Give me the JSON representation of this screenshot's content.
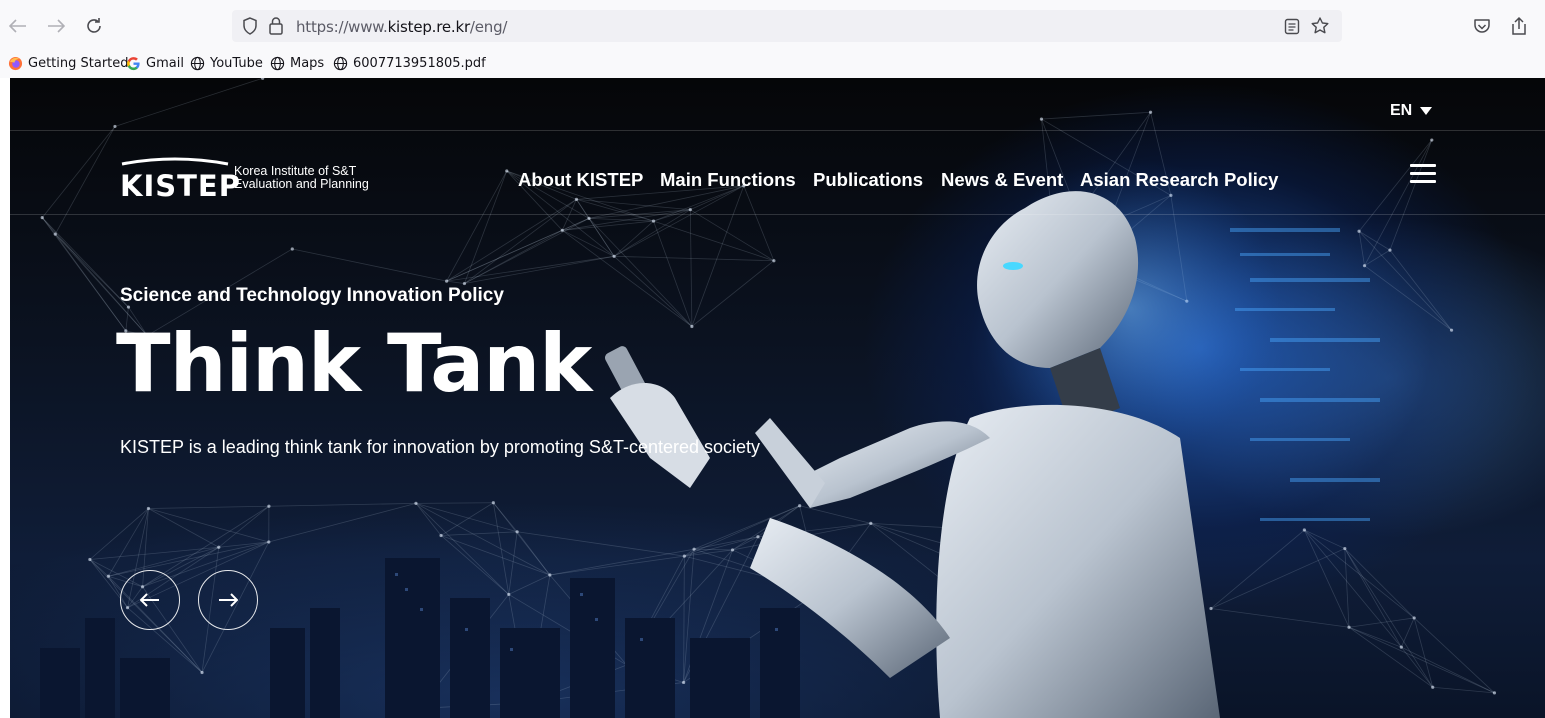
{
  "browser": {
    "url_prefix": "https://www.",
    "url_domain": "kistep.re.kr",
    "url_path": "/eng/",
    "bookmarks": [
      {
        "label": "Getting Started",
        "icon": "firefox-icon"
      },
      {
        "label": "Gmail",
        "icon": "google-icon"
      },
      {
        "label": "YouTube",
        "icon": "globe-icon"
      },
      {
        "label": "Maps",
        "icon": "globe-icon"
      },
      {
        "label": "6007713951805.pdf",
        "icon": "globe-icon"
      }
    ]
  },
  "site": {
    "language": "EN",
    "logo_text": "KISTEP",
    "logo_sub_line1": "Korea Institute of S&T",
    "logo_sub_line2": "Evaluation and Planning",
    "nav": [
      "About KISTEP",
      "Main Functions",
      "Publications",
      "News & Event",
      "Asian Research Policy"
    ]
  },
  "hero": {
    "eyebrow": "Science and Technology Innovation Policy",
    "headline": "Think Tank",
    "description": "KISTEP is a leading think tank for innovation by promoting S&T-centered society",
    "prev_arrow": "←",
    "next_arrow": "→"
  },
  "colors": {
    "toolbar_bg": "#f9f9fb",
    "urlbar_bg": "#f0f0f4",
    "hero_text": "#ffffff",
    "hero_glow": "#2a6edc"
  }
}
